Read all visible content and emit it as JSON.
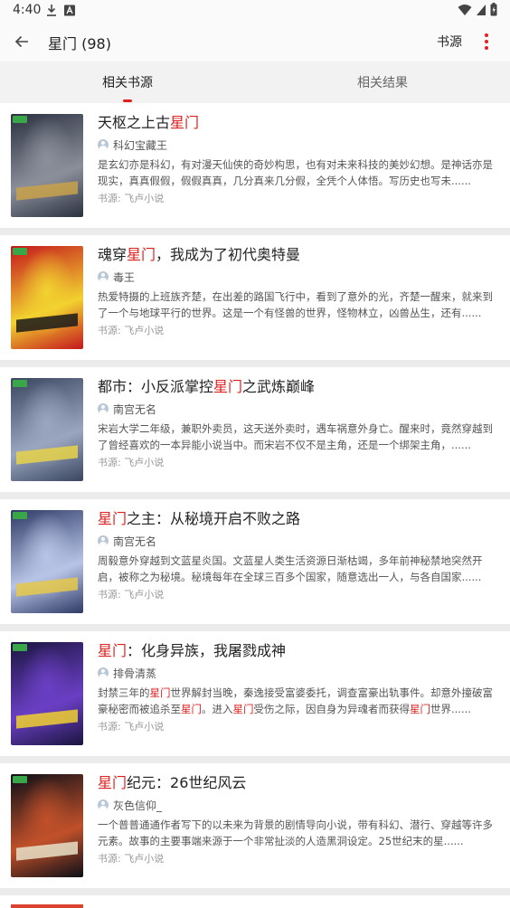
{
  "status_bar": {
    "time": "4:40"
  },
  "app_bar": {
    "title": "星门 (98)",
    "source_label": "书源"
  },
  "tabs": [
    {
      "label": "相关书源",
      "active": true
    },
    {
      "label": "相关结果",
      "active": false
    }
  ],
  "books": [
    {
      "title_parts": [
        [
          "天枢之上古",
          false
        ],
        [
          "星门",
          true
        ]
      ],
      "author": "科幻宝藏王",
      "intro_parts": [
        [
          "是玄幻亦是科幻，有对漫天仙侠的奇妙构思，也有对未来科技的美妙幻想。是神话亦是现实，真真假假，假假真真，几分真来几分假，全凭个人体悟。写历史也写未......",
          false
        ]
      ],
      "origin": "书源: 飞卢小说",
      "cover_colors": [
        "#2b3140",
        "#8a8f9a",
        "#c9a24a"
      ]
    },
    {
      "title_parts": [
        [
          "魂穿",
          false
        ],
        [
          "星门",
          true
        ],
        [
          "，我成为了初代奥特曼",
          false
        ]
      ],
      "author": "毒王",
      "intro_parts": [
        [
          "热爱特摄的上班族齐楚，在出差的路国飞行中，看到了意外的光，齐楚一醒来，就来到了一个与地球平行的世界。这是一个有怪兽的世界，怪物林立，凶兽丛生，还有......",
          false
        ]
      ],
      "origin": "书源: 飞卢小说",
      "cover_colors": [
        "#c4161c",
        "#f2d230",
        "#1a1a1a"
      ]
    },
    {
      "title_parts": [
        [
          "都市：小反派掌控",
          false
        ],
        [
          "星门",
          true
        ],
        [
          "之武炼巅峰",
          false
        ]
      ],
      "author": "南宫无名",
      "intro_parts": [
        [
          "宋岩大学二年级，兼职外卖员，这天送外卖时，遇车祸意外身亡。醒来时，竟然穿越到了曾经喜欢的一本异能小说当中。而宋岩不仅不是主角，还是一个绑架主角，......",
          false
        ]
      ],
      "origin": "书源: 飞卢小说",
      "cover_colors": [
        "#3a4660",
        "#9aa6c0",
        "#e8d24a"
      ]
    },
    {
      "title_parts": [
        [
          "星门",
          true
        ],
        [
          "之主：从秘境开启不败之路",
          false
        ]
      ],
      "author": "南宫无名",
      "intro_parts": [
        [
          "周毅意外穿越到文蓝星炎国。文蓝星人类生活资源日渐枯竭，多年前神秘禁地突然开启，被称之为秘境。秘境每年在全球三百多个国家，随意选出一人，与各自国家......",
          false
        ]
      ],
      "origin": "书源: 飞卢小说",
      "cover_colors": [
        "#2f3a66",
        "#b7c4e6",
        "#e6c84a"
      ]
    },
    {
      "title_parts": [
        [
          "星门",
          true
        ],
        [
          "：化身异族，我屠戮成神",
          false
        ]
      ],
      "author": "排骨清蒸",
      "intro_parts": [
        [
          "封禁三年的",
          false
        ],
        [
          "星门",
          true
        ],
        [
          "世界解封当晚，秦逸接受富婆委托，调查富豪出轨事件。却意外撞破富豪秘密而被追杀至",
          false
        ],
        [
          "星门",
          true
        ],
        [
          "。进入",
          false
        ],
        [
          "星门",
          true
        ],
        [
          "受伤之际，因自身为异魂者而获得",
          false
        ],
        [
          "星门",
          true
        ],
        [
          "世界......",
          false
        ]
      ],
      "origin": "书源: 飞卢小说",
      "cover_colors": [
        "#1b1540",
        "#6a3fc4",
        "#f0d030"
      ]
    },
    {
      "title_parts": [
        [
          "星门",
          true
        ],
        [
          "纪元：26世纪风云",
          false
        ]
      ],
      "author": "灰色信仰_",
      "intro_parts": [
        [
          "一个普普通通作者写下的以未来为背景的剧情导向小说，带有科幻、潜行、穿越等许多元素。故事的主要事端来源于一个非常扯淡的人造黑洞设定。25世纪末的星......",
          false
        ]
      ],
      "origin": "书源: 飞卢小说",
      "cover_colors": [
        "#0d0f18",
        "#c0502a",
        "#e8e0c8"
      ]
    }
  ],
  "accent_color": "#e02020"
}
